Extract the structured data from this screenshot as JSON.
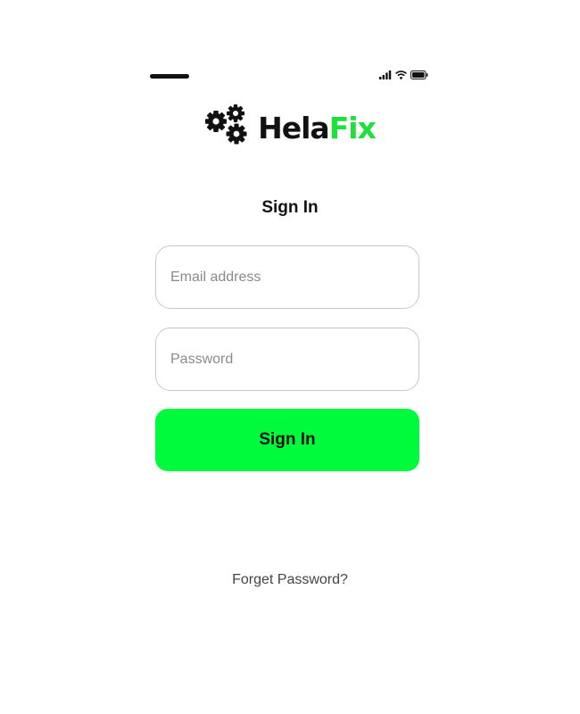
{
  "status_bar": {
    "icons": [
      "signal-icon",
      "wifi-icon",
      "battery-icon"
    ]
  },
  "logo": {
    "icon": "gears-icon",
    "text_part_a": "Hela",
    "text_part_b": "Fix",
    "accent_color": "#1fe03a"
  },
  "form": {
    "title": "Sign In",
    "email_placeholder": "Email address",
    "password_placeholder": "Password",
    "submit_label": "Sign In",
    "submit_color": "#00fa3c",
    "forgot_label": "Forget Password?"
  }
}
